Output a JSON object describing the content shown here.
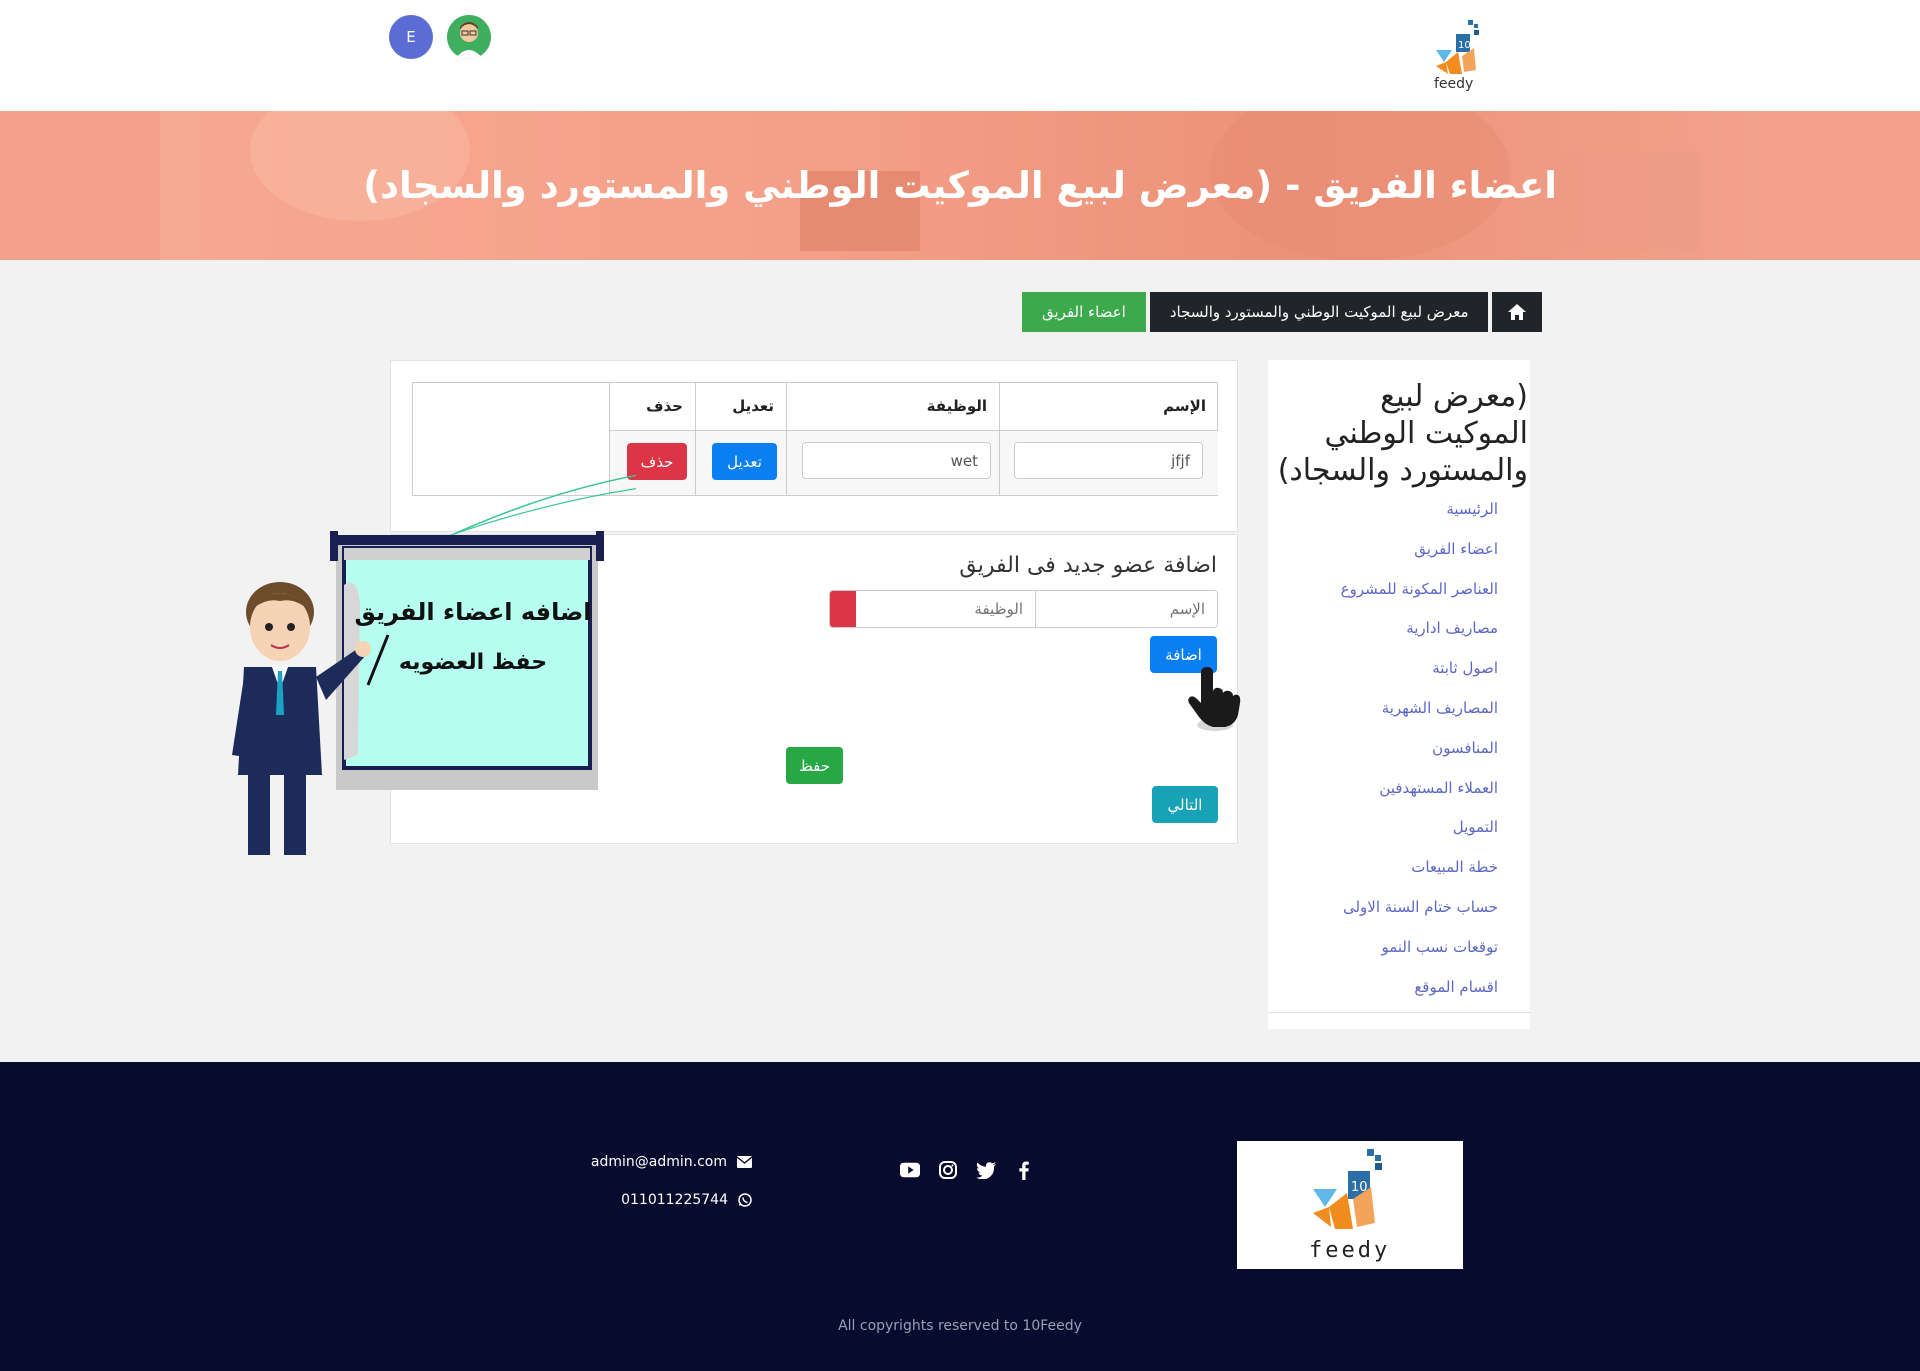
{
  "header": {
    "logo_text": "feedy",
    "avatar_initial": "E"
  },
  "hero": {
    "title": "اعضاء الفريق - (معرض لبيع الموكيت الوطني والمستورد والسجاد)"
  },
  "breadcrumb": {
    "project": "معرض لبيع الموكيت الوطني والمستورد والسجاد",
    "current": "اعضاء الفريق"
  },
  "sidebar": {
    "title": "(معرض لبيع الموكيت الوطني والمستورد والسجاد)",
    "items": [
      "الرئيسية",
      "اعضاء الفريق",
      "العناصر المكونة للمشروع",
      "مصاريف ادارية",
      "اصول ثابتة",
      "المصاريف الشهرية",
      "المنافسون",
      "العملاء المستهدفين",
      "التمويل",
      "خطة المبيعات",
      "حساب ختام السنة الاولى",
      "توقعات نسب النمو",
      "اقسام الموقع"
    ]
  },
  "table": {
    "headers": {
      "name": "الإسم",
      "job": "الوظيفة",
      "edit": "تعديل",
      "delete": "حذف"
    },
    "rows": [
      {
        "name": "jfjf",
        "job": "wet",
        "edit_label": "تعديل",
        "delete_label": "حذف"
      }
    ]
  },
  "add_form": {
    "title": "اضافة عضو جديد فى الفريق",
    "name_placeholder": "الإسم",
    "job_placeholder": "الوظيفة",
    "add_label": "اضافة",
    "save_label": "حفظ",
    "next_label": "التالي"
  },
  "tutorial": {
    "line1": "اضافه اعضاء الفريق",
    "line2": "حفظ العضويه"
  },
  "footer": {
    "email": "admin@admin.com",
    "phone": "011011225744",
    "copyright": "All copyrights reserved to 10Feedy",
    "social": [
      "facebook-icon",
      "twitter-icon",
      "instagram-icon",
      "youtube-icon"
    ]
  },
  "colors": {
    "primary_blue": "#0a7ff2",
    "danger_red": "#dc3545",
    "success_green": "#28a745",
    "info_teal": "#17a2b8",
    "footer_bg": "#070b2e",
    "hero_bg": "#f4a28b"
  }
}
